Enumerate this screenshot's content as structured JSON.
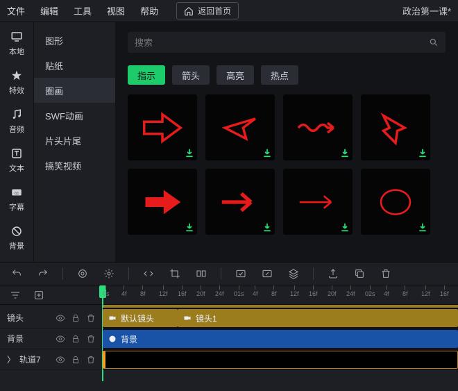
{
  "menu": {
    "file": "文件",
    "edit": "编辑",
    "tools": "工具",
    "view": "视图",
    "help": "帮助",
    "home": "返回首页"
  },
  "project_name": "政治第一课*",
  "side": [
    {
      "label": "本地"
    },
    {
      "label": "特效"
    },
    {
      "label": "音频"
    },
    {
      "label": "文本"
    },
    {
      "label": "字幕"
    },
    {
      "label": "背景"
    }
  ],
  "categories": [
    {
      "label": "图形",
      "active": false
    },
    {
      "label": "贴纸",
      "active": false
    },
    {
      "label": "圈画",
      "active": true
    },
    {
      "label": "SWF动画",
      "active": false
    },
    {
      "label": "片头片尾",
      "active": false
    },
    {
      "label": "搞笑视频",
      "active": false
    }
  ],
  "search": {
    "placeholder": "搜索"
  },
  "tabs": [
    {
      "label": "指示",
      "active": true
    },
    {
      "label": "箭头",
      "active": false
    },
    {
      "label": "高亮",
      "active": false
    },
    {
      "label": "热点",
      "active": false
    }
  ],
  "timeline": {
    "ticks": [
      "0s",
      "4f",
      "8f",
      "12f",
      "16f",
      "20f",
      "24f",
      "01s",
      "4f",
      "8f",
      "12f",
      "16f",
      "20f",
      "24f",
      "02s",
      "4f",
      "8f",
      "12f",
      "16f"
    ],
    "tracks": [
      {
        "name": "镜头"
      },
      {
        "name": "背景"
      },
      {
        "name": "轨道7",
        "expandable": true
      }
    ],
    "clips": {
      "shot_default": "默认镜头",
      "shot_1": "镜头1",
      "bg": "背景"
    }
  }
}
